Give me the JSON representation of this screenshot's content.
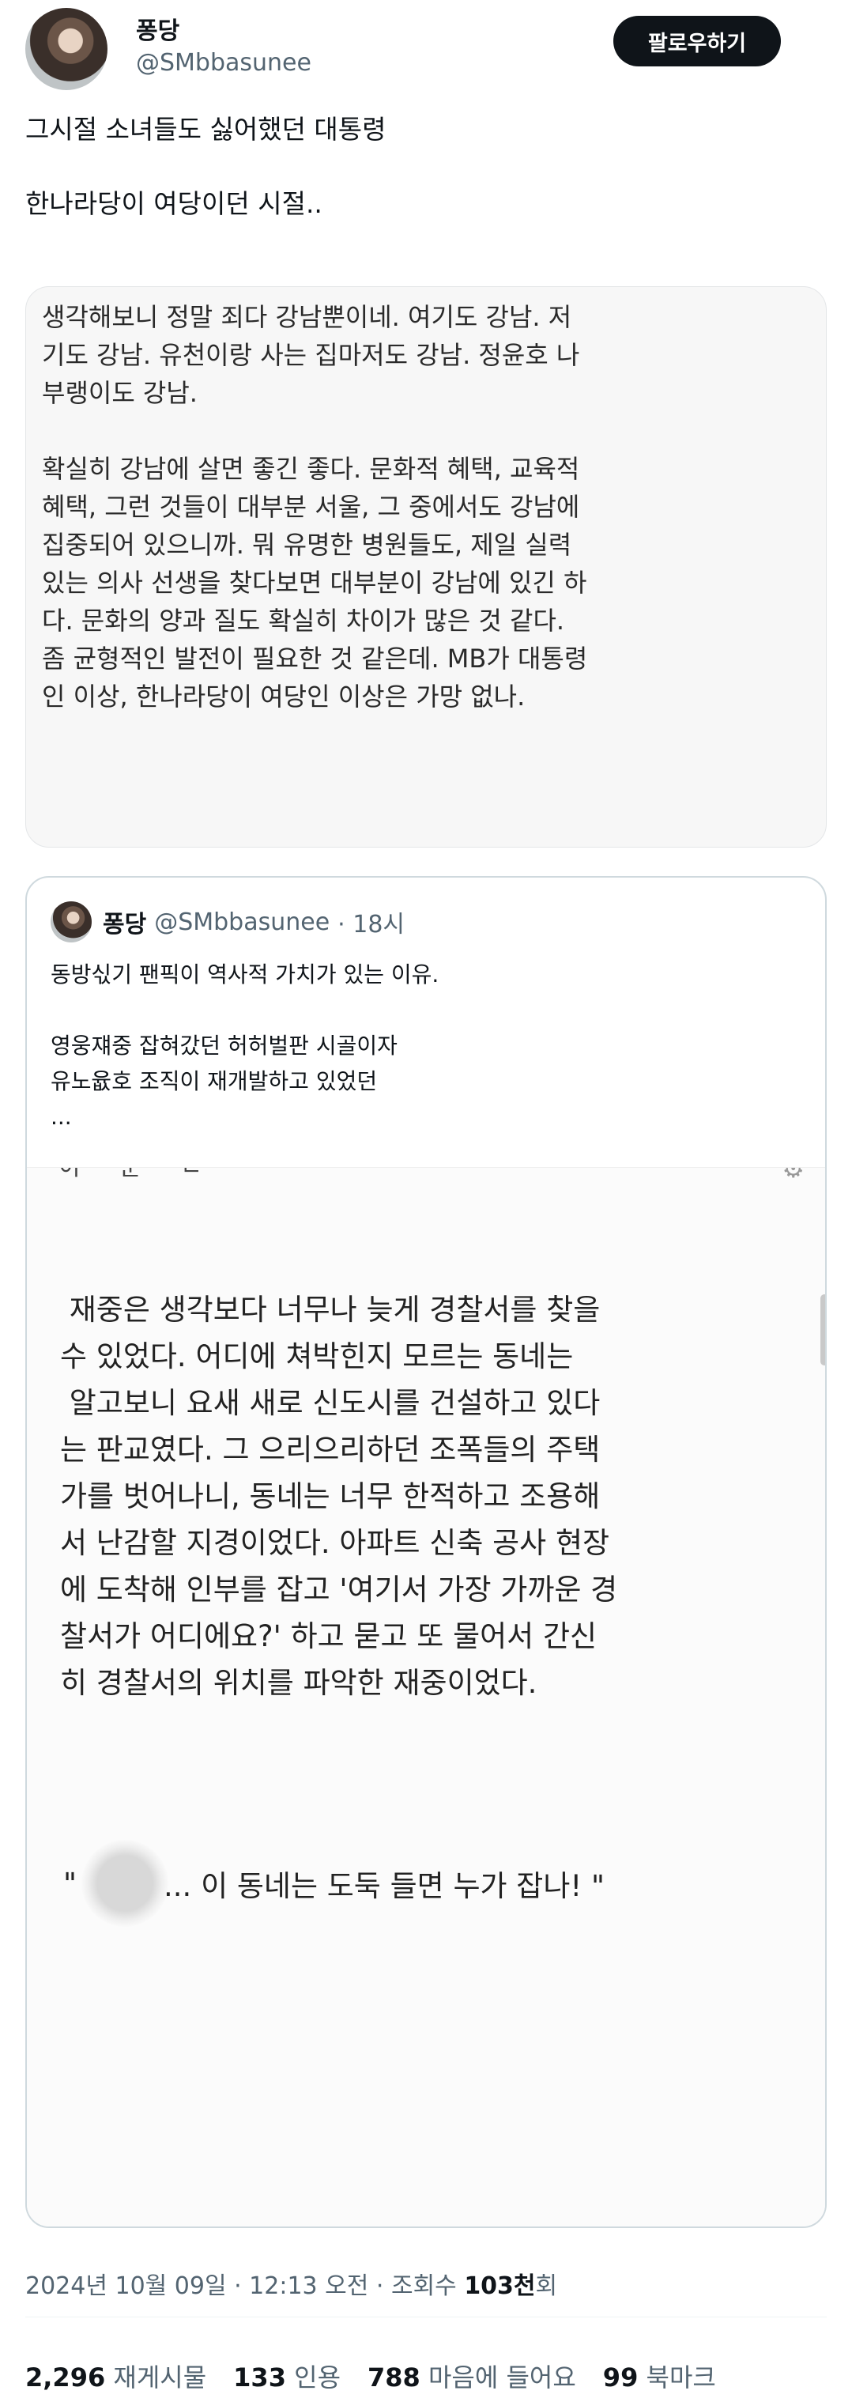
{
  "author": {
    "name": "퐁당",
    "handle": "@SMbbasunee",
    "follow_label": "팔로우하기"
  },
  "tweet": {
    "lines": [
      "그시절 소녀들도 싫어했던 대통령",
      "",
      "한나라당이 여당이던 시절.."
    ]
  },
  "note_image": {
    "lines": [
      "생각해보니 정말 죄다 강남뿐이네. 여기도 강남. 저",
      "기도 강남. 유천이랑 사는 집마저도 강남. 정윤호 나",
      "부랭이도 강남.",
      "",
      "확실히 강남에 살면 좋긴 좋다. 문화적 혜택, 교육적",
      "혜택, 그런 것들이 대부분 서울, 그 중에서도 강남에",
      "집중되어 있으니까. 뭐 유명한 병원들도, 제일 실력",
      "있는 의사 선생을 찾다보면 대부분이 강남에 있긴 하",
      "다. 문화의 양과 질도 확실히 차이가 많은 것 같다.",
      "좀 균형적인 발전이 필요한 것 같은데. MB가 대통령",
      "인 이상, 한나라당이 여당인 이상은 가망 없나."
    ]
  },
  "quote": {
    "name": "퐁당",
    "handle": "@SMbbasunee",
    "time": "· 18시",
    "lines": [
      "동방싟기 팬픽이 역사적 가치가 있는 이유.",
      "",
      "영웅쟤중 잡혀갔던 허허벌판 시골이자",
      "유노윲호 조직이 재개발하고 있었던",
      "..."
    ],
    "image": {
      "cut_text": "이 문 ㄹ",
      "story_lines": [
        " 재중은 생각보다 너무나 늦게 경찰서를 찾을",
        "수 있었다. 어디에 쳐박힌지 모르는 동네는",
        " 알고보니 요새 새로 신도시를 건설하고 있다",
        "는 판교였다. 그 으리으리하던 조폭들의 주택",
        "가를 벗어나니, 동네는 너무 한적하고 조용해",
        "서 난감할 지경이었다. 아파트 신축 공사 현장",
        "에 도착해 인부를 잡고 '여기서 가장 가까운 경",
        "찰서가 어디에요?' 하고 묻고 또 물어서 간신",
        "히 경찰서의 위치를 파악한 재중이었다."
      ],
      "dialog_open": "\" ",
      "dialog_rest": "... 이 동네는 도둑 들면 누가 잡나! \""
    }
  },
  "meta": {
    "timestamp": "2024년 10월 09일 · 12:13 오전 · 조회수 ",
    "views": "103천",
    "views_suffix": "회"
  },
  "stats": [
    {
      "num": "2,296",
      "label": "재게시물"
    },
    {
      "num": "133",
      "label": "인용"
    },
    {
      "num": "788",
      "label": "마음에 들어요"
    },
    {
      "num": "99",
      "label": "북마크"
    }
  ]
}
